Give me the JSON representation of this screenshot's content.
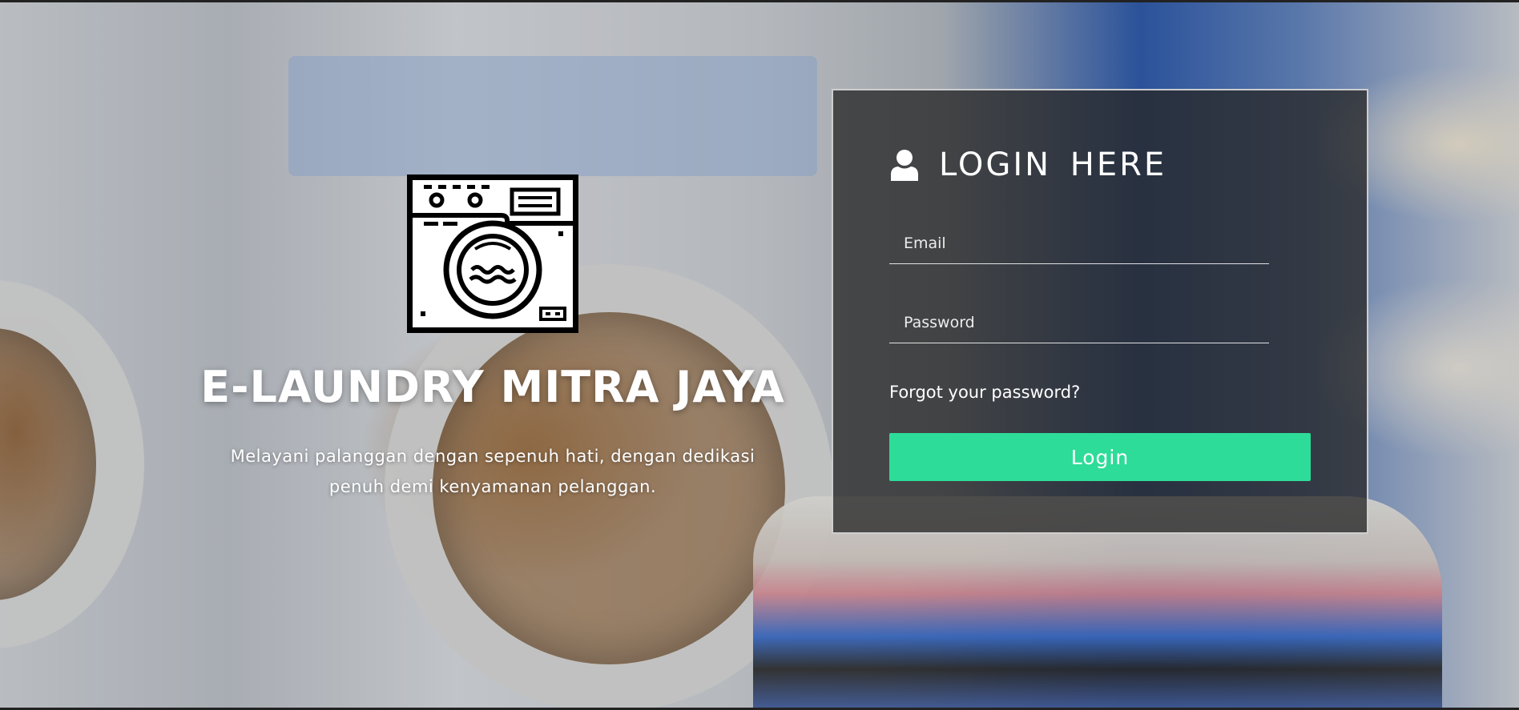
{
  "brand": {
    "logo_icon": "washing-machine-icon",
    "title": "E-LAUNDRY MITRA JAYA",
    "tagline": "Melayani palanggan dengan sepenuh hati, dengan dedikasi penuh demi kenyamanan pelanggan."
  },
  "login": {
    "header_icon": "user-icon",
    "title": "LOGIN HERE",
    "email_placeholder": "Email",
    "password_placeholder": "Password",
    "forgot_link": "Forgot your password?",
    "submit_label": "Login"
  },
  "colors": {
    "accent": "#2ddc98",
    "panel": "rgba(40,40,40,0.78)",
    "text": "#ffffff"
  }
}
